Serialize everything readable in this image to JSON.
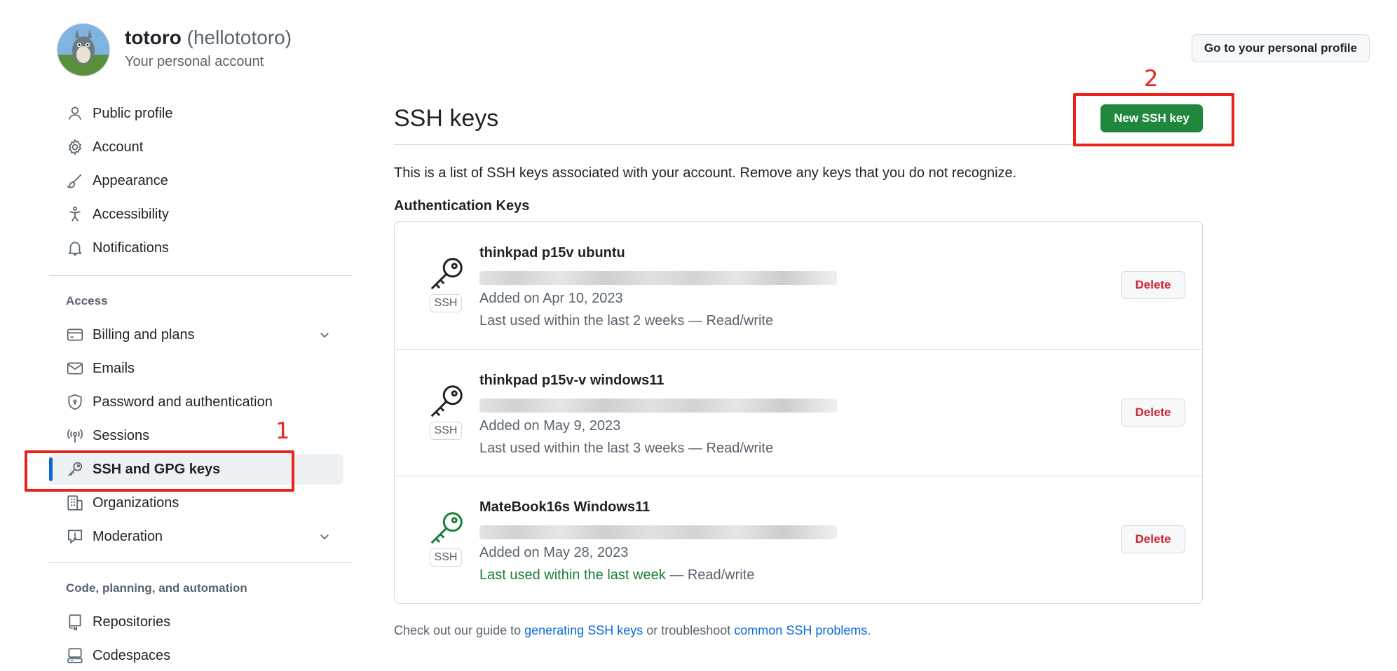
{
  "account": {
    "name": "totoro",
    "login": "(hellototoro)",
    "subtitle": "Your personal account",
    "profile_button": "Go to your personal profile"
  },
  "sidebar": {
    "items": [
      {
        "label": "Public profile",
        "icon": "person-icon"
      },
      {
        "label": "Account",
        "icon": "gear-icon"
      },
      {
        "label": "Appearance",
        "icon": "paintbrush-icon"
      },
      {
        "label": "Accessibility",
        "icon": "accessibility-icon"
      },
      {
        "label": "Notifications",
        "icon": "bell-icon"
      }
    ],
    "access_header": "Access",
    "access_items": [
      {
        "label": "Billing and plans",
        "icon": "credit-card-icon",
        "expandable": true
      },
      {
        "label": "Emails",
        "icon": "mail-icon"
      },
      {
        "label": "Password and authentication",
        "icon": "shield-icon"
      },
      {
        "label": "Sessions",
        "icon": "broadcast-icon"
      },
      {
        "label": "SSH and GPG keys",
        "icon": "key-icon",
        "active": true
      },
      {
        "label": "Organizations",
        "icon": "organization-icon"
      },
      {
        "label": "Moderation",
        "icon": "report-icon",
        "expandable": true
      }
    ],
    "code_header": "Code, planning, and automation",
    "code_items": [
      {
        "label": "Repositories",
        "icon": "repo-icon"
      },
      {
        "label": "Codespaces",
        "icon": "codespaces-icon"
      }
    ]
  },
  "main": {
    "title": "SSH keys",
    "new_key_button": "New SSH key",
    "description": "This is a list of SSH keys associated with your account. Remove any keys that you do not recognize.",
    "auth_header": "Authentication Keys",
    "keys": [
      {
        "title": "thinkpad p15v ubuntu",
        "badge": "SSH",
        "added": "Added on Apr 10, 2023",
        "last_used": "Last used within the last 2 weeks",
        "access": " — Read/write",
        "recent": false,
        "delete_label": "Delete"
      },
      {
        "title": "thinkpad p15v-v windows11",
        "badge": "SSH",
        "added": "Added on May 9, 2023",
        "last_used": "Last used within the last 3 weeks",
        "access": " — Read/write",
        "recent": false,
        "delete_label": "Delete"
      },
      {
        "title": "MateBook16s Windows11",
        "badge": "SSH",
        "added": "Added on May 28, 2023",
        "last_used": "Last used within the last week",
        "access": " — Read/write",
        "recent": true,
        "delete_label": "Delete"
      }
    ],
    "footer": {
      "prefix": "Check out our guide to ",
      "link1": "generating SSH keys",
      "middle": " or troubleshoot ",
      "link2": "common SSH problems",
      "suffix": "."
    }
  },
  "annotations": {
    "step1": "1",
    "step2": "2",
    "color": "#e8231b"
  },
  "colors": {
    "accent_blue": "#0969da",
    "primary_green": "#1f883d",
    "danger_red": "#d1242f",
    "recent_green": "#1a7f37"
  }
}
